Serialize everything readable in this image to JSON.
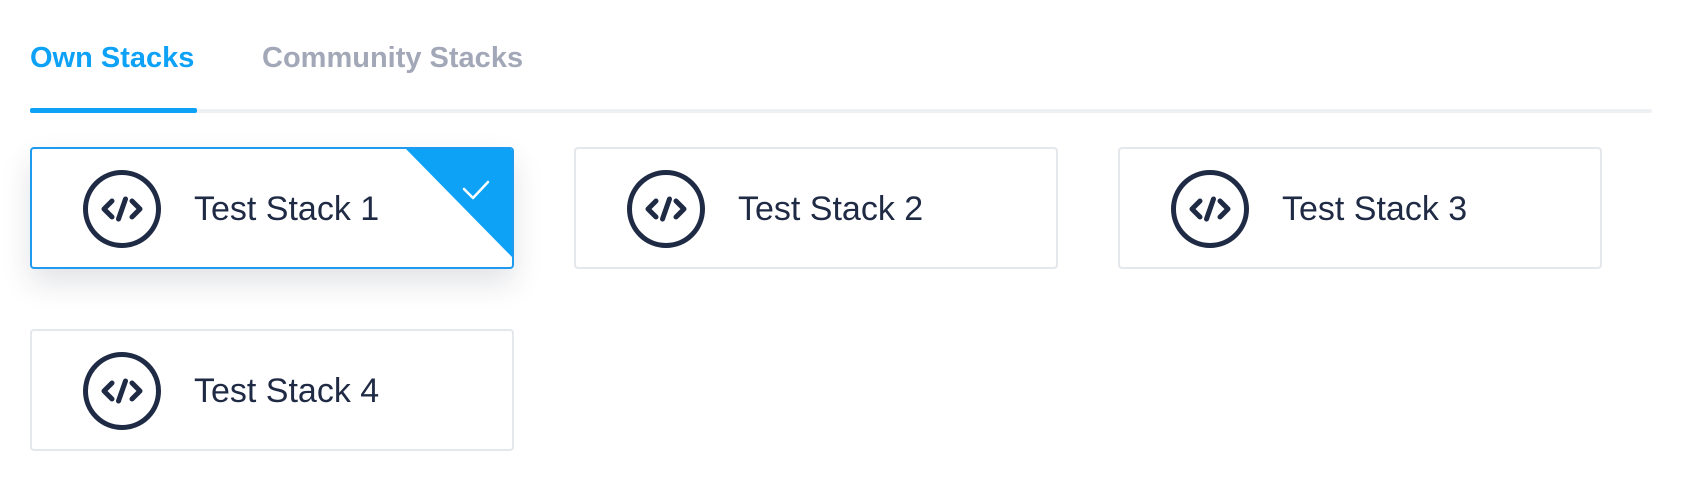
{
  "tabs": {
    "own_label": "Own Stacks",
    "community_label": "Community Stacks",
    "active": "Own Stacks"
  },
  "stacks": [
    {
      "label": "Test Stack 1",
      "icon": "code-icon",
      "selected": true
    },
    {
      "label": "Test Stack 2",
      "icon": "code-icon",
      "selected": false
    },
    {
      "label": "Test Stack 3",
      "icon": "code-icon",
      "selected": false
    },
    {
      "label": "Test Stack 4",
      "icon": "code-icon",
      "selected": false
    }
  ],
  "colors": {
    "accent": "#0ea2f7",
    "tab_inactive": "#a3a8b8",
    "icon": "#1f2a44",
    "text": "#1f2a44",
    "card_border": "#e4e7ec"
  }
}
